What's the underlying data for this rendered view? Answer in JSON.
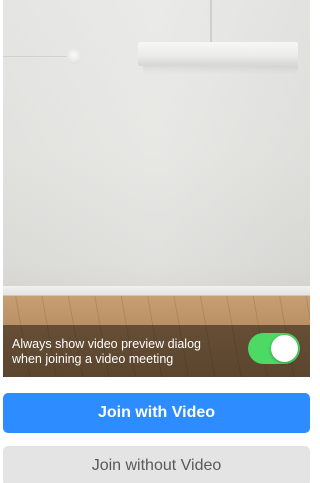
{
  "preview": {
    "toggle": {
      "label_line1": "Always show video preview dialog",
      "label_line2": "when joining a video meeting",
      "state": "on",
      "color_on": "#4cd964"
    }
  },
  "actions": {
    "join_with_video": "Join with Video",
    "join_without_video": "Join without Video",
    "primary_color": "#2d8cff"
  }
}
